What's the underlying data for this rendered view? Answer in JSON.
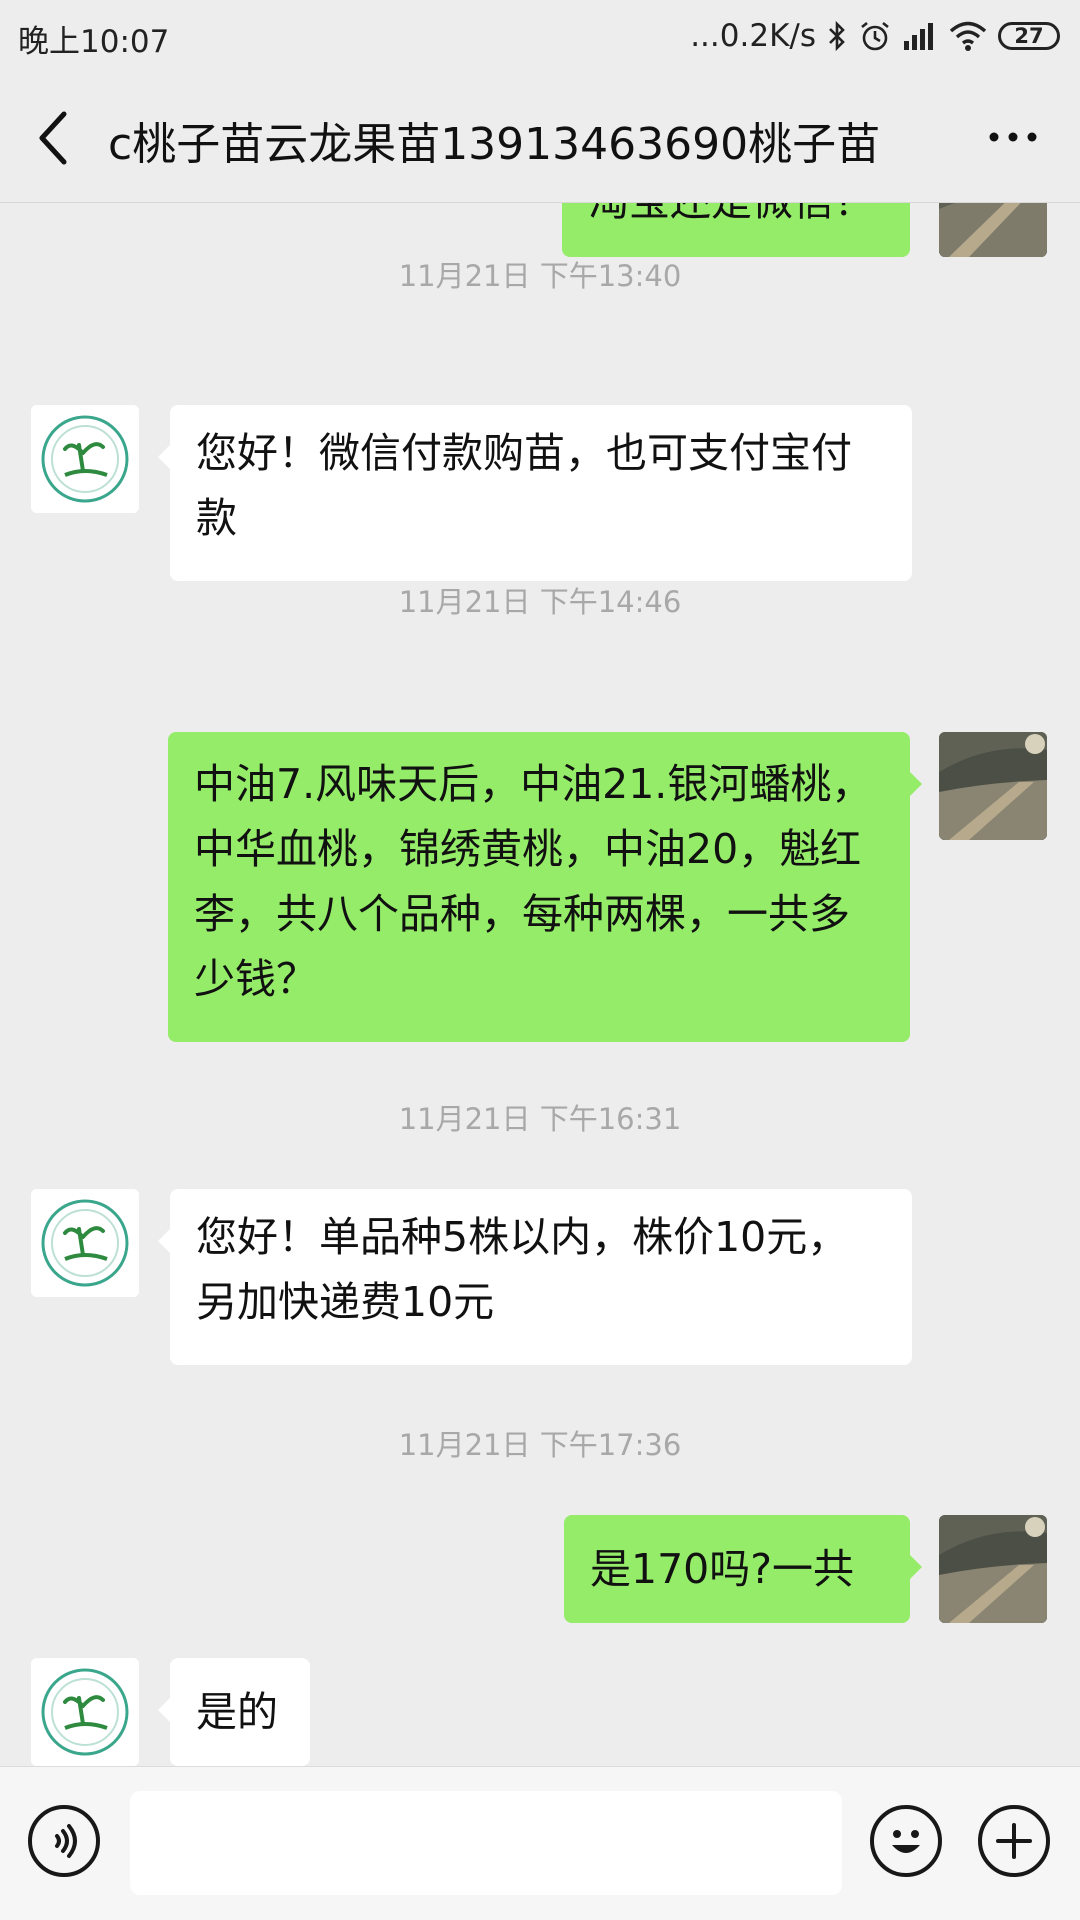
{
  "status_bar": {
    "time": "晚上10:07",
    "network_speed": "...0.2K/s",
    "battery": "27",
    "icons": [
      "bluetooth-icon",
      "alarm-icon",
      "signal-icon",
      "wifi-icon",
      "battery-icon"
    ]
  },
  "header": {
    "title": "c桃子苗云龙果苗13913463690桃子苗",
    "back_icon": "chevron-left-icon",
    "more_icon": "more-dots-icon"
  },
  "messages": [
    {
      "type": "text",
      "side": "right",
      "text": "淘宝还是微信？"
    },
    {
      "type": "time",
      "text": "11月21日 下午13:40"
    },
    {
      "type": "text",
      "side": "left",
      "text": "您好！微信付款购苗，也可支付宝付款"
    },
    {
      "type": "time",
      "text": "11月21日 下午14:46"
    },
    {
      "type": "text",
      "side": "right",
      "text": "中油7.风味天后，中油21.银河蟠桃，中华血桃，锦绣黄桃，中油20，魁红李，共八个品种，每种两棵，一共多少钱？"
    },
    {
      "type": "time",
      "text": "11月21日 下午16:31"
    },
    {
      "type": "text",
      "side": "left",
      "text": "您好！单品种5株以内，株价10元，另加快递费10元"
    },
    {
      "type": "time",
      "text": "11月21日 下午17:36"
    },
    {
      "type": "text",
      "side": "right",
      "text": "是170吗?一共"
    },
    {
      "type": "text",
      "side": "left",
      "text": "是的"
    }
  ],
  "input_bar": {
    "placeholder": "",
    "voice_icon": "voice-icon",
    "emoji_icon": "emoji-icon",
    "plus_icon": "plus-icon"
  },
  "colors": {
    "background": "#ededed",
    "sent_bubble": "#95ec69",
    "received_bubble": "#ffffff",
    "timestamp": "#a8a8a8"
  }
}
